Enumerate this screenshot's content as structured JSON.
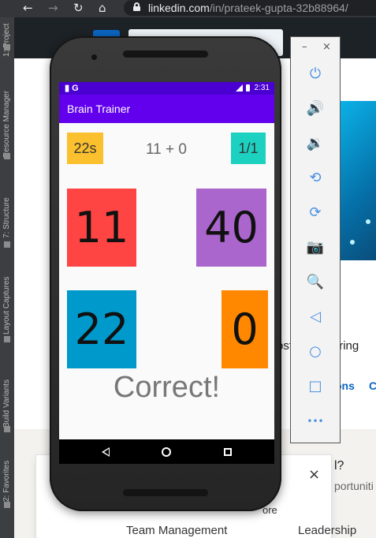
{
  "browser": {
    "back_icon": "←",
    "forward_icon": "→",
    "reload_icon": "↻",
    "home_icon": "⌂",
    "url_host": "linkedin.com",
    "url_path": "/in/prateek-gupta-32b88964/"
  },
  "ide_sidebar": {
    "tabs": [
      {
        "label": "1: Project"
      },
      {
        "label": "Resource Manager"
      },
      {
        "label": "7: Structure"
      },
      {
        "label": "Layout Captures"
      },
      {
        "label": "Build Variants"
      },
      {
        "label": "2: Favorites"
      }
    ]
  },
  "linkedin": {
    "headline_partial": "ost Engineering",
    "link_partial": "ons",
    "link_partial_2": "C",
    "modal_line1": "l?",
    "modal_line2": "portuniti",
    "modal_more": "ore",
    "modal_close": "×",
    "tab_left": "Team Management",
    "tab_right": "Leadership"
  },
  "status_bar": {
    "left_icons": "▮ G",
    "time": "2:31"
  },
  "app": {
    "title": "Brain Trainer",
    "timer": "22s",
    "question": "11 + 0",
    "score": "1/1",
    "answers": [
      "11",
      "40",
      "22",
      "0"
    ],
    "result": "Correct!",
    "colors": {
      "app_bar": "#6200ee",
      "status_bar": "#4a00d1",
      "timer": "#fbc02d",
      "score": "#1dd1c0",
      "answer_1": "#ff4444",
      "answer_2": "#aa66cc",
      "answer_3": "#0099cc",
      "answer_4": "#ff8800"
    }
  },
  "emulator_panel": {
    "minimize": "–",
    "close": "×",
    "tools": [
      {
        "icon": "power-icon",
        "glyph": "⏻"
      },
      {
        "icon": "volume-up-icon",
        "glyph": "🔊"
      },
      {
        "icon": "volume-down-icon",
        "glyph": "🔉"
      },
      {
        "icon": "rotate-left-icon",
        "glyph": "⟲"
      },
      {
        "icon": "rotate-right-icon",
        "glyph": "⟳"
      },
      {
        "icon": "camera-icon",
        "glyph": "📷"
      },
      {
        "icon": "zoom-icon",
        "glyph": "🔍"
      },
      {
        "icon": "back-icon",
        "glyph": "◁"
      },
      {
        "icon": "home-icon",
        "glyph": "○"
      },
      {
        "icon": "overview-icon",
        "glyph": "□"
      },
      {
        "icon": "more-icon",
        "glyph": "•••"
      }
    ]
  }
}
